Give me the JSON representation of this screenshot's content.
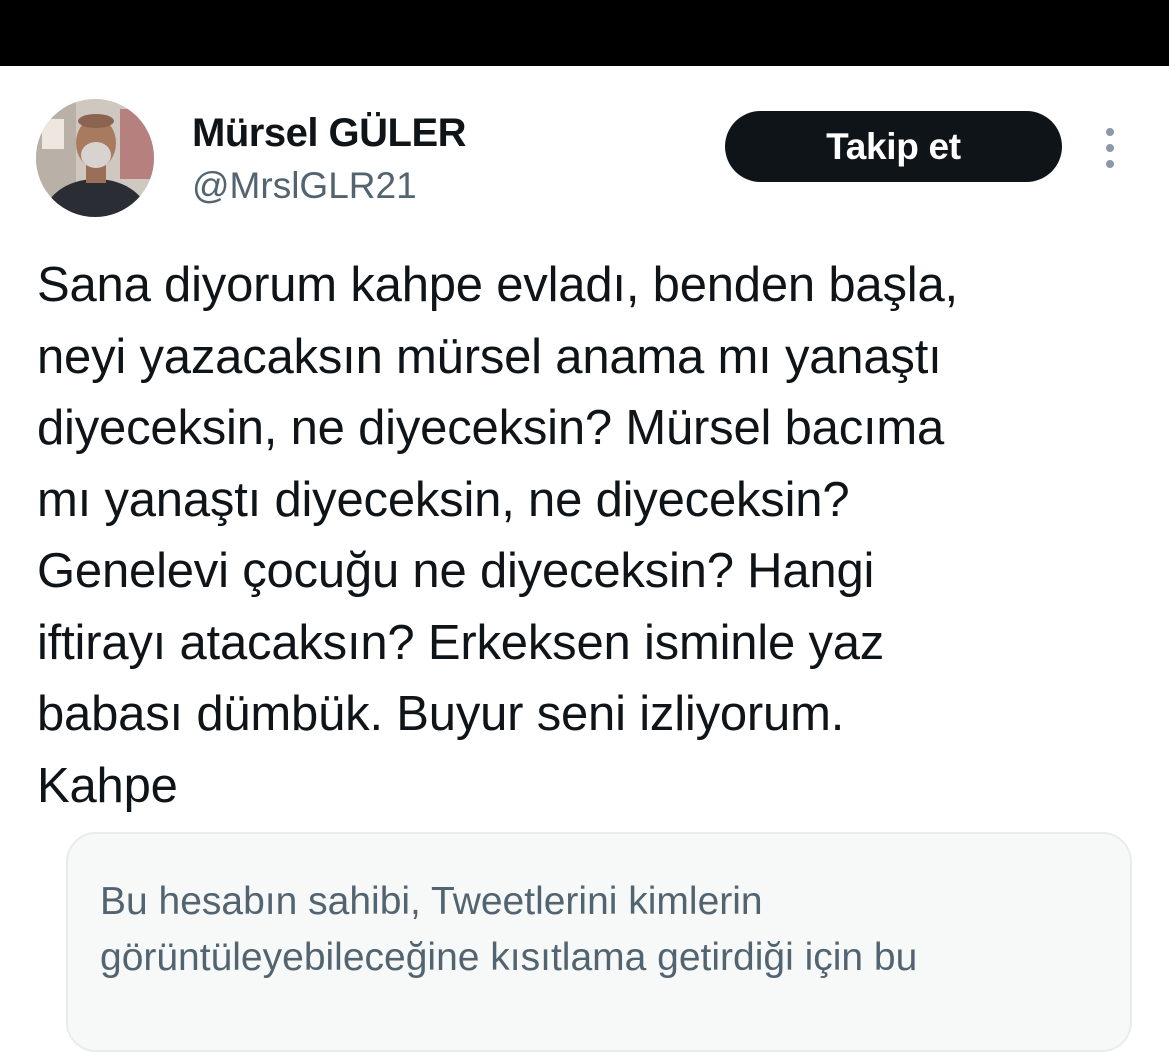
{
  "status_bar": {
    "color": "#000000"
  },
  "author": {
    "display_name": "Mürsel GÜLER",
    "handle": "@MrslGLR21"
  },
  "actions": {
    "follow_label": "Takip et",
    "more_icon": "more-vertical-icon"
  },
  "tweet": {
    "text": "Sana diyorum kahpe evladı, benden başla,\nneyi yazacaksın mürsel anama mı yanaştı\ndiyeceksin, ne diyeceksin? Mürsel bacıma\nmı yanaştı diyeceksin, ne diyeceksin?\nGenelevi çocuğu ne diyeceksin? Hangi\niftirayı atacaksın? Erkeksen isminle yaz\nbabası dümbük. Buyur seni izliyorum.\nKahpe"
  },
  "notice": {
    "text": "Bu hesabın sahibi, Tweetlerini kimlerin\ngörüntüleyebileceğine kısıtlama getirdiği için bu"
  },
  "colors": {
    "text_primary": "#0f1419",
    "text_secondary": "#536471",
    "button_bg": "#0f1419",
    "notice_bg": "#f7f9f9"
  }
}
